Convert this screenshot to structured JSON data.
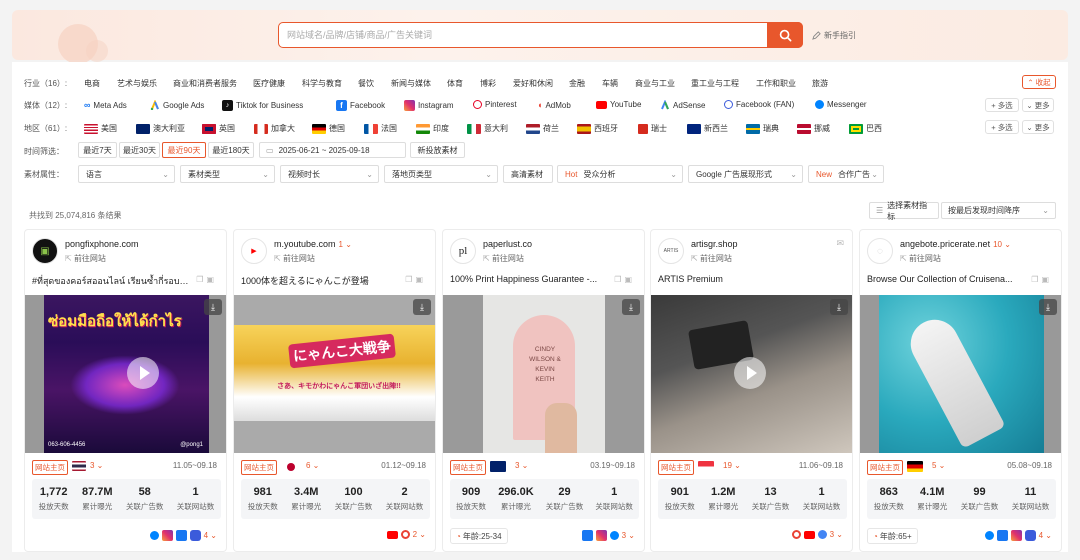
{
  "search": {
    "placeholder": "网站域名/品牌/店铺/商品/广告关键词",
    "guide": "新手指引"
  },
  "filters": {
    "industry": {
      "label": "行业（16）:",
      "items": [
        "电商",
        "艺术与娱乐",
        "商业和消费者服务",
        "医疗健康",
        "科学与教育",
        "餐饮",
        "新闻与媒体",
        "体育",
        "博彩",
        "爱好和休闲",
        "金融",
        "车辆",
        "商业与工业",
        "重工业与工程",
        "工作和职业",
        "旅游"
      ],
      "collapse": "收起"
    },
    "media": {
      "label": "媒体（12）:",
      "items": [
        "Meta Ads",
        "Google Ads",
        "Tiktok for Business",
        "Facebook",
        "Instagram",
        "Pinterest",
        "AdMob",
        "YouTube",
        "AdSense",
        "Facebook (FAN)",
        "Messenger"
      ],
      "multi": "多选",
      "more": "更多"
    },
    "region": {
      "label": "地区（61）:",
      "items": [
        "美国",
        "澳大利亚",
        "英国",
        "加拿大",
        "德国",
        "法国",
        "印度",
        "意大利",
        "荷兰",
        "西班牙",
        "瑞士",
        "新西兰",
        "瑞典",
        "挪威",
        "巴西"
      ],
      "multi": "多选",
      "more": "更多"
    },
    "time": {
      "label": "时间筛选：",
      "options": [
        "最近7天",
        "最近30天",
        "最近90天",
        "最近180天"
      ],
      "active": "最近90天",
      "range": "2025-06-21 ~ 2025-09-18",
      "newest": "新投放素材"
    },
    "material": {
      "label": "素材属性：",
      "selects": [
        "语言",
        "素材类型",
        "视频时长",
        "落地页类型"
      ],
      "hd": "高清素材",
      "hot_tag": "Hot",
      "audience": "受众分析",
      "google_format": "Google 广告展现形式",
      "new_tag": "New",
      "partner": "合作广告"
    }
  },
  "results": {
    "count_text": "共找到 25,074,816 条结果",
    "indicator_btn": "选择素材指标",
    "sort": "按最后发现时间降序"
  },
  "stat_labels": [
    "投放天数",
    "累计曝光",
    "关联广告数",
    "关联网站数"
  ],
  "homepage_badge": "网站主页",
  "goto_label": "前往网站",
  "cards": [
    {
      "domain": "pongfixphone.com",
      "dnum": "",
      "title": "#ที่สุดของคอร์สออนไลน์ เรียนซ้ำกี่รอบก็...",
      "media_text": "ซ่อมมือถือให้ได้กำไร",
      "media_sub": "063-606-4456",
      "media_sub2": "@pong1",
      "ccount": "3",
      "date": "11.05~09.18",
      "stats": [
        "1,772",
        "87.7M",
        "58",
        "1"
      ],
      "age": "",
      "scount": "4"
    },
    {
      "domain": "m.youtube.com",
      "dnum": "1",
      "title": "1000体を超えるにゃんこが登場",
      "media_text": "にゃんこ大戦争",
      "media_sub": "さあ、キモかわにゃんこ軍団いざ出陣!!",
      "media_sub2": "",
      "ccount": "6",
      "date": "01.12~09.18",
      "stats": [
        "981",
        "3.4M",
        "100",
        "2"
      ],
      "age": "",
      "scount": "2"
    },
    {
      "domain": "paperlust.co",
      "dnum": "",
      "title": "100% Print Happiness Guarantee -...",
      "media_text": "CINDY WILSON & KEVIN KEITH",
      "media_sub": "",
      "media_sub2": "",
      "ccount": "3",
      "date": "03.19~09.18",
      "stats": [
        "909",
        "296.0K",
        "29",
        "1"
      ],
      "age": "年龄:25-34",
      "scount": "3"
    },
    {
      "domain": "artisgr.shop",
      "dnum": "",
      "title": "ARTIS Premium",
      "media_text": "",
      "media_sub": "",
      "media_sub2": "",
      "ccount": "19",
      "date": "11.06~09.18",
      "stats": [
        "901",
        "1.2M",
        "13",
        "1"
      ],
      "age": "",
      "scount": "3"
    },
    {
      "domain": "angebote.pricerate.net",
      "dnum": "10",
      "title": "Browse Our Collection of Cruisena...",
      "media_text": "",
      "media_sub": "",
      "media_sub2": "",
      "ccount": "5",
      "date": "05.08~09.18",
      "stats": [
        "863",
        "4.1M",
        "99",
        "11"
      ],
      "age": "年龄:65+",
      "scount": "4"
    }
  ],
  "colors": {
    "accent": "#e8572c",
    "bg": "#f3f3f3"
  }
}
